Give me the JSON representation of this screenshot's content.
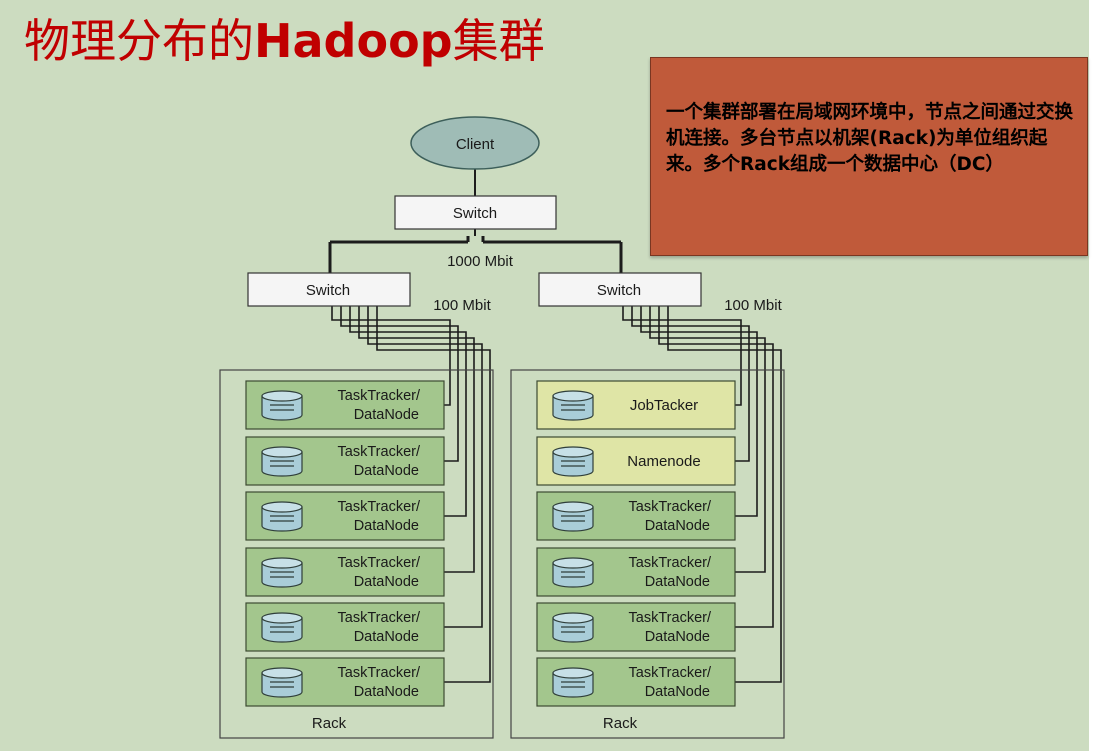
{
  "slide": {
    "title_cn_prefix": "物理分布的",
    "title_latin": "Hadoop",
    "title_cn_suffix": "集群",
    "callout_text": "一个集群部署在局域网环境中，节点之间通过交换机连接。多台节点以机架(Rack)为单位组织起来。多个Rack组成一个数据中心（DC）"
  },
  "diagram": {
    "client_label": "Client",
    "core_switch_label": "Switch",
    "uplink_speed": "1000 Mbit",
    "racks": [
      {
        "switch_label": "Switch",
        "link_speed": "100 Mbit",
        "rack_label": "Rack",
        "nodes": [
          {
            "line1": "TaskTracker/",
            "line2": "DataNode",
            "kind": "worker"
          },
          {
            "line1": "TaskTracker/",
            "line2": "DataNode",
            "kind": "worker"
          },
          {
            "line1": "TaskTracker/",
            "line2": "DataNode",
            "kind": "worker"
          },
          {
            "line1": "TaskTracker/",
            "line2": "DataNode",
            "kind": "worker"
          },
          {
            "line1": "TaskTracker/",
            "line2": "DataNode",
            "kind": "worker"
          },
          {
            "line1": "TaskTracker/",
            "line2": "DataNode",
            "kind": "worker"
          }
        ]
      },
      {
        "switch_label": "Switch",
        "link_speed": "100 Mbit",
        "rack_label": "Rack",
        "nodes": [
          {
            "line1": "JobTacker",
            "line2": "",
            "kind": "master"
          },
          {
            "line1": "Namenode",
            "line2": "",
            "kind": "master"
          },
          {
            "line1": "TaskTracker/",
            "line2": "DataNode",
            "kind": "worker"
          },
          {
            "line1": "TaskTracker/",
            "line2": "DataNode",
            "kind": "worker"
          },
          {
            "line1": "TaskTracker/",
            "line2": "DataNode",
            "kind": "worker"
          },
          {
            "line1": "TaskTracker/",
            "line2": "DataNode",
            "kind": "worker"
          }
        ]
      }
    ]
  },
  "colors": {
    "background": "#ccdcc0",
    "title": "#c00000",
    "callout_fill": "#c05a3a",
    "client_fill": "#9fbcb6",
    "worker_fill": "#a3c68d",
    "master_fill": "#dfe5a6",
    "disk_fill": "#a9cdd8"
  },
  "icons": {
    "disk": "database-cylinder-icon"
  }
}
